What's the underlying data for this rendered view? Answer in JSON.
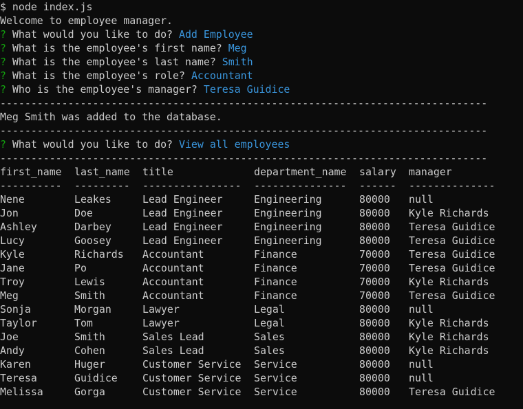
{
  "terminal": {
    "command": "$ node index.js",
    "welcome": "Welcome to employee manager.",
    "prompt_marker": "?",
    "prompts": [
      {
        "question": "What would you like to do?",
        "answer": "Add Employee"
      },
      {
        "question": "What is the employee's first name?",
        "answer": "Meg"
      },
      {
        "question": "What is the employee's last name?",
        "answer": "Smith"
      },
      {
        "question": "What is the employee's role?",
        "answer": "Accountant"
      },
      {
        "question": "Who is the employee's manager?",
        "answer": "Teresa Guidice"
      }
    ],
    "separator": "-------------------------------------------------------------------------------",
    "added_message": "Meg Smith was added to the database.",
    "prompt2": {
      "question": "What would you like to do?",
      "answer": "View all employees"
    }
  },
  "table": {
    "headers": [
      "first_name",
      "last_name",
      "title",
      "department_name",
      "salary",
      "manager"
    ],
    "underlines": [
      "----------",
      "---------",
      "----------------",
      "---------------",
      "------",
      "--------------"
    ],
    "rows": [
      [
        "Nene",
        "Leakes",
        "Lead Engineer",
        "Engineering",
        "80000",
        "null"
      ],
      [
        "Jon",
        "Doe",
        "Lead Engineer",
        "Engineering",
        "80000",
        "Kyle Richards"
      ],
      [
        "Ashley",
        "Darbey",
        "Lead Engineer",
        "Engineering",
        "80000",
        "Teresa Guidice"
      ],
      [
        "Lucy",
        "Goosey",
        "Lead Engineer",
        "Engineering",
        "80000",
        "Teresa Guidice"
      ],
      [
        "Kyle",
        "Richards",
        "Accountant",
        "Finance",
        "70000",
        "Teresa Guidice"
      ],
      [
        "Jane",
        "Po",
        "Accountant",
        "Finance",
        "70000",
        "Teresa Guidice"
      ],
      [
        "Troy",
        "Lewis",
        "Accountant",
        "Finance",
        "70000",
        "Kyle Richards"
      ],
      [
        "Meg",
        "Smith",
        "Accountant",
        "Finance",
        "70000",
        "Teresa Guidice"
      ],
      [
        "Sonja",
        "Morgan",
        "Lawyer",
        "Legal",
        "80000",
        "null"
      ],
      [
        "Taylor",
        "Tom",
        "Lawyer",
        "Legal",
        "80000",
        "Kyle Richards"
      ],
      [
        "Joe",
        "Smith",
        "Sales Lead",
        "Sales",
        "80000",
        "Kyle Richards"
      ],
      [
        "Andy",
        "Cohen",
        "Sales Lead",
        "Sales",
        "80000",
        "Kyle Richards"
      ],
      [
        "Karen",
        "Huger",
        "Customer Service",
        "Service",
        "80000",
        "null"
      ],
      [
        "Teresa",
        "Guidice",
        "Customer Service",
        "Service",
        "80000",
        "null"
      ],
      [
        "Melissa",
        "Gorga",
        "Customer Service",
        "Service",
        "80000",
        "Teresa Guidice"
      ]
    ]
  },
  "colors": {
    "background": "#0c0c0c",
    "text": "#cccccc",
    "prompt_marker": "#13a10e",
    "answer": "#3a96dd"
  }
}
